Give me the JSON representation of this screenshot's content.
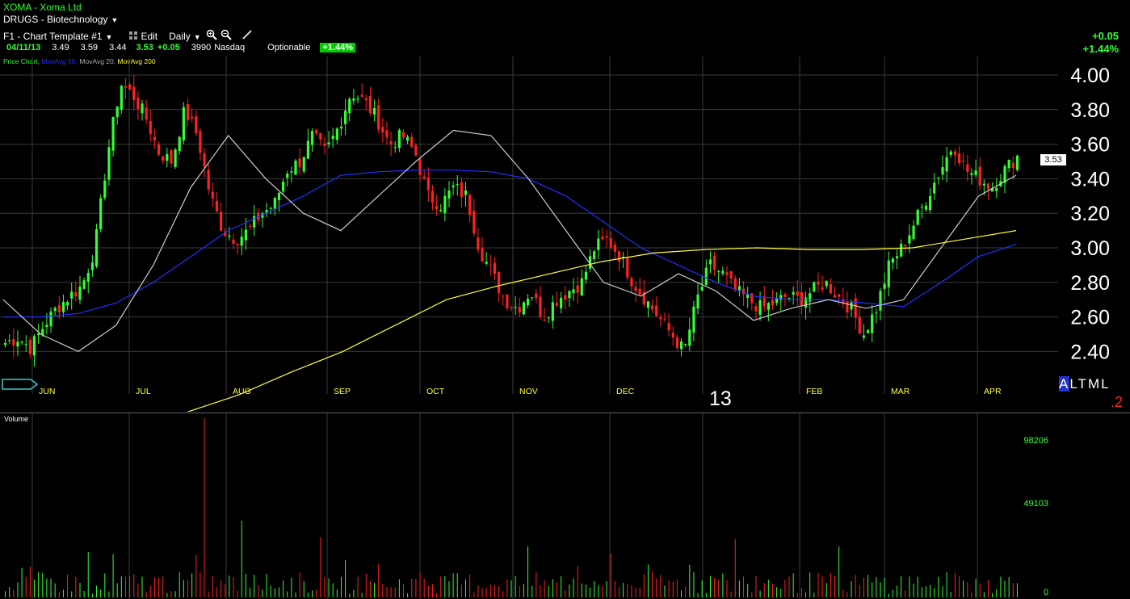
{
  "header": {
    "symbol_title": "XOMA - Xoma Ltd",
    "sector": "DRUGS - Biotechnology",
    "template": "F1 - Chart Template #1",
    "edit_label": "Edit",
    "interval": "Daily"
  },
  "quote": {
    "date": "04/11/13",
    "open": "3.49",
    "high": "3.59",
    "low": "3.44",
    "last": "3.53",
    "change": "+0.05",
    "volume": "3990",
    "exchange": "Nasdaq",
    "optionable": "Optionable",
    "pct": "+1.44%"
  },
  "change_display": {
    "abs": "+0.05",
    "pct": "+1.44%"
  },
  "indicators": {
    "price_chart": "Price Chart",
    "ma50": "MovAvg 50",
    "ma20": "MovAvg 20",
    "ma200": "MovAvg 200",
    "sep": ","
  },
  "colors": {
    "up": "#33ff33",
    "down": "#ff2020",
    "ma20": "#cccccc",
    "ma50": "#2030ff",
    "ma200": "#ffff33",
    "grid": "#3a3a3a",
    "month_label": "#ffff33"
  },
  "price_scale": {
    "ticks": [
      "4.00",
      "3.80",
      "3.60",
      "3.40",
      "3.20",
      "3.00",
      "2.80",
      "2.60",
      "2.40"
    ],
    "last_price_tag": "3.53"
  },
  "period_buttons": {
    "a": "A",
    "l": "L",
    "t": "T",
    "m": "M",
    "l2": "L"
  },
  "period_extra": ".2",
  "year_label": "13",
  "volume_panel": {
    "label": "Volume",
    "ticks": [
      "98206",
      "49103",
      "0"
    ]
  },
  "chart_data": {
    "type": "candlestick",
    "x_months": [
      "JUN",
      "JUL",
      "AUG",
      "SEP",
      "OCT",
      "NOV",
      "DEC",
      "13",
      "FEB",
      "MAR",
      "APR"
    ],
    "ylim": [
      2.3,
      4.05
    ],
    "anchor_closes": [
      2.45,
      2.48,
      2.42,
      2.55,
      2.65,
      2.72,
      2.78,
      3.0,
      3.55,
      3.95,
      3.88,
      3.75,
      3.55,
      3.5,
      3.8,
      3.65,
      3.3,
      3.1,
      3.05,
      3.1,
      3.2,
      3.25,
      3.45,
      3.5,
      3.65,
      3.55,
      3.7,
      3.9,
      3.85,
      3.75,
      3.6,
      3.65,
      3.55,
      3.3,
      3.25,
      3.35,
      3.3,
      3.0,
      2.85,
      2.7,
      2.65,
      2.75,
      2.6,
      2.7,
      2.75,
      2.8,
      3.0,
      3.05,
      2.95,
      2.8,
      2.7,
      2.6,
      2.5,
      2.4,
      2.7,
      2.9,
      2.85,
      2.75,
      2.7,
      2.65,
      2.68,
      2.72,
      2.7,
      2.75,
      2.8,
      2.72,
      2.65,
      2.5,
      2.65,
      2.9,
      3.0,
      3.15,
      3.3,
      3.45,
      3.6,
      3.45,
      3.4,
      3.35,
      3.45,
      3.53
    ],
    "ma50": {
      "name": "MovAvg 50",
      "values": [
        2.6,
        2.6,
        2.62,
        2.68,
        2.8,
        2.95,
        3.1,
        3.2,
        3.3,
        3.42,
        3.44,
        3.45,
        3.45,
        3.44,
        3.4,
        3.3,
        3.15,
        3.0,
        2.9,
        2.8,
        2.72,
        2.7,
        2.7,
        2.68,
        2.66,
        2.8,
        2.95,
        3.02
      ]
    },
    "ma20": {
      "name": "MovAvg 20",
      "values": [
        2.7,
        2.5,
        2.4,
        2.55,
        2.9,
        3.35,
        3.65,
        3.4,
        3.2,
        3.1,
        3.3,
        3.5,
        3.68,
        3.65,
        3.4,
        3.1,
        2.8,
        2.72,
        2.85,
        2.75,
        2.58,
        2.65,
        2.7,
        2.65,
        2.7,
        3.0,
        3.3,
        3.42
      ]
    },
    "ma200": {
      "name": "MovAvg 200",
      "values": [
        2.05,
        2.15,
        2.28,
        2.4,
        2.55,
        2.7,
        2.78,
        2.85,
        2.92,
        2.97,
        2.99,
        3.0,
        2.99,
        2.99,
        3.0,
        3.05,
        3.1
      ]
    },
    "volume_peak_index": 20
  }
}
